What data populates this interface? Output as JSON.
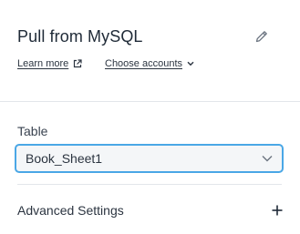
{
  "header": {
    "title": "Pull from MySQL",
    "learn_more_label": "Learn more",
    "choose_accounts_label": "Choose accounts"
  },
  "table_field": {
    "label": "Table",
    "selected_value": "Book_Sheet1"
  },
  "advanced": {
    "label": "Advanced Settings"
  },
  "icons": {
    "edit": "pencil-icon",
    "external_link": "external-link-icon",
    "dropdown": "chevron-down-icon",
    "expand": "plus-icon"
  },
  "colors": {
    "focus_border": "#4aa7e6",
    "text": "#1f2a37",
    "divider": "#e3e6ea"
  }
}
